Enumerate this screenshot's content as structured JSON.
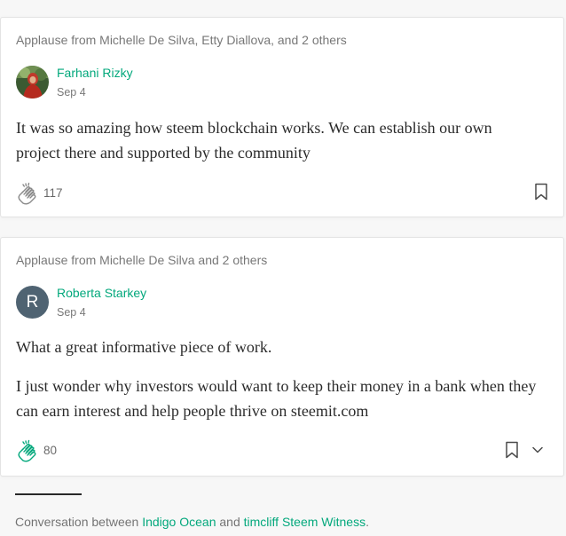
{
  "colors": {
    "accent": "#03a87c",
    "background": "#f7f7f7",
    "avatar_letter_bg": "#4f6372"
  },
  "responses": [
    {
      "applause_text": "Applause from Michelle De Silva, Etty Diallova, and 2 others",
      "author": "Farhani Rizky",
      "avatar_type": "photo",
      "date": "Sep 4",
      "paragraphs": [
        "It was so amazing how steem blockchain works. We can establish our own project there and supported by the community"
      ],
      "clap_count": "117",
      "icons": [
        "clap-icon",
        "bookmark-icon"
      ]
    },
    {
      "applause_text": "Applause from Michelle De Silva and 2 others",
      "author": "Roberta Starkey",
      "avatar_type": "letter",
      "avatar_letter": "R",
      "date": "Sep 4",
      "paragraphs": [
        "What a great informative piece of work.",
        "I just wonder why investors would want to keep their money in a bank when they can earn interest and help people thrive on steemit.com"
      ],
      "clap_count": "80",
      "icons": [
        "clap-icon",
        "bookmark-icon",
        "chevron-down-icon"
      ]
    }
  ],
  "conversation": {
    "prefix": "Conversation between ",
    "person1": "Indigo Ocean",
    "joiner": " and ",
    "person2": "timcliff Steem Witness",
    "suffix": "."
  }
}
